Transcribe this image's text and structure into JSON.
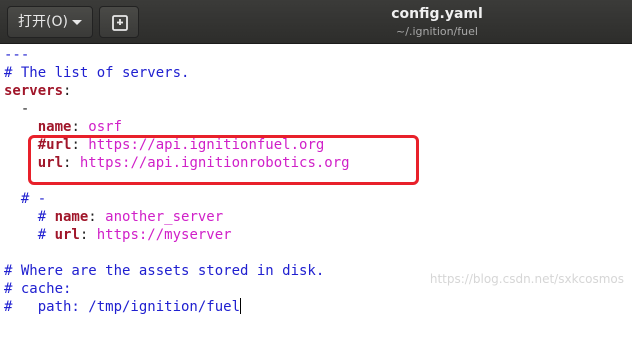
{
  "header": {
    "open_label": "打开(O)",
    "title": "config.yaml",
    "subtitle": "~/.ignition/fuel"
  },
  "icons": {
    "open_dropdown": "chevron-down-icon",
    "save": "save-document-icon"
  },
  "editor": {
    "l1": "---",
    "l2": "# The list of servers.",
    "l3_key": "servers",
    "l3_sep": ":",
    "l4": "  -",
    "l5_key": "name",
    "l5_sep": ": ",
    "l5_val": "osrf",
    "l6_key": "#url",
    "l6_sep": ": ",
    "l6_val": "https://api.ignitionfuel.org",
    "l7_key": "url",
    "l7_sep": ": ",
    "l7_val": "https://api.ignitionrobotics.org",
    "l8": "  # -",
    "l9_hash": "    # ",
    "l9_key": "name",
    "l9_sep": ": ",
    "l9_val": "another_server",
    "l10_hash": "    # ",
    "l10_key": "url",
    "l10_sep": ": ",
    "l10_val": "https://myserver",
    "l11": "# Where are the assets stored in disk.",
    "l12": "# cache:",
    "l13": "#   path: /tmp/ignition/fuel"
  },
  "colors": {
    "comment": "#2020d0",
    "key": "#a0162a",
    "string": "#d020c8",
    "highlight_box": "#e8202a"
  },
  "watermark": "https://blog.csdn.net/sxkcosmos"
}
